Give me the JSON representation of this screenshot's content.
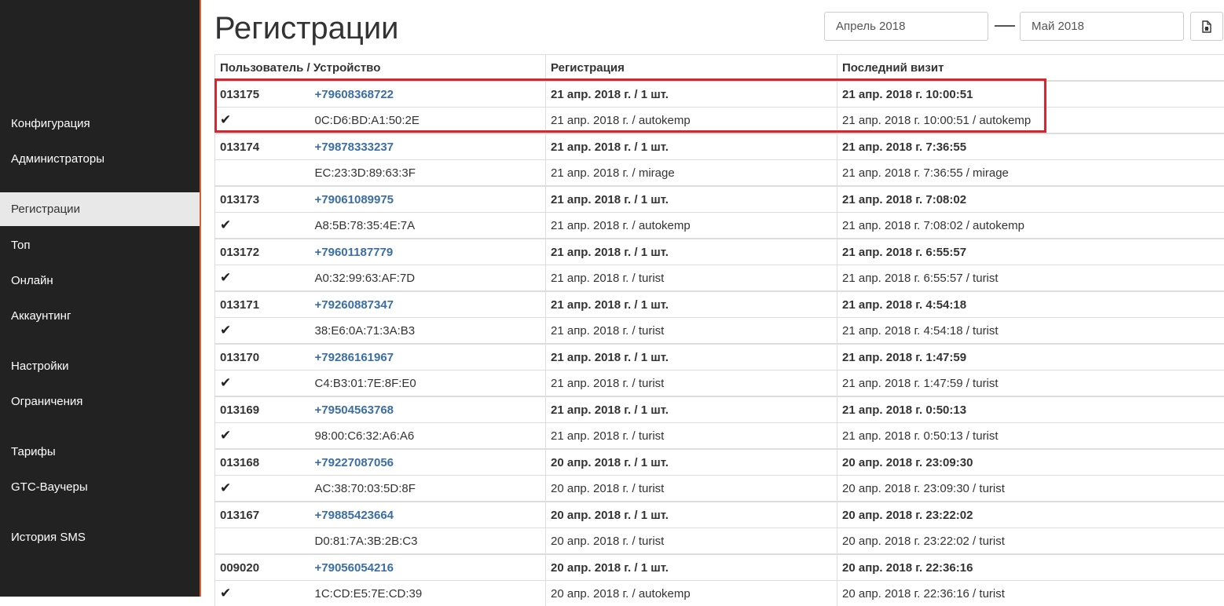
{
  "sidebar": {
    "items": [
      {
        "label": "Конфигурация",
        "active": false
      },
      {
        "label": "Администраторы",
        "active": false
      },
      {
        "label": "Регистрации",
        "active": true
      },
      {
        "label": "Топ",
        "active": false
      },
      {
        "label": "Онлайн",
        "active": false
      },
      {
        "label": "Аккаунтинг",
        "active": false
      },
      {
        "label": "Настройки",
        "active": false
      },
      {
        "label": "Ограничения",
        "active": false
      },
      {
        "label": "Тарифы",
        "active": false
      },
      {
        "label": "GTC-Ваучеры",
        "active": false
      },
      {
        "label": "История SMS",
        "active": false
      }
    ]
  },
  "header": {
    "title": "Регистрации",
    "date_from": "Апрель 2018",
    "date_to": "Май 2018",
    "export_icon": "file-export-icon"
  },
  "table": {
    "columns": [
      "Пользователь / Устройство",
      "Регистрация",
      "Последний визит"
    ],
    "rows": [
      {
        "id": "013175",
        "phone": "+79608368722",
        "reg": "21 апр. 2018 г. / 1 шт.",
        "visit": "21 апр. 2018 г. 10:00:51",
        "check": true,
        "mac": "0C:D6:BD:A1:50:2E",
        "reg_sub": "21 апр. 2018 г. / autokemp",
        "visit_sub": "21 апр. 2018 г. 10:00:51 / autokemp"
      },
      {
        "id": "013174",
        "phone": "+79878333237",
        "reg": "21 апр. 2018 г. / 1 шт.",
        "visit": "21 апр. 2018 г. 7:36:55",
        "check": false,
        "mac": "EC:23:3D:89:63:3F",
        "reg_sub": "21 апр. 2018 г. / mirage",
        "visit_sub": "21 апр. 2018 г. 7:36:55 / mirage"
      },
      {
        "id": "013173",
        "phone": "+79061089975",
        "reg": "21 апр. 2018 г. / 1 шт.",
        "visit": "21 апр. 2018 г. 7:08:02",
        "check": true,
        "mac": "A8:5B:78:35:4E:7A",
        "reg_sub": "21 апр. 2018 г. / autokemp",
        "visit_sub": "21 апр. 2018 г. 7:08:02 / autokemp"
      },
      {
        "id": "013172",
        "phone": "+79601187779",
        "reg": "21 апр. 2018 г. / 1 шт.",
        "visit": "21 апр. 2018 г. 6:55:57",
        "check": true,
        "mac": "A0:32:99:63:AF:7D",
        "reg_sub": "21 апр. 2018 г. / turist",
        "visit_sub": "21 апр. 2018 г. 6:55:57 / turist"
      },
      {
        "id": "013171",
        "phone": "+79260887347",
        "reg": "21 апр. 2018 г. / 1 шт.",
        "visit": "21 апр. 2018 г. 4:54:18",
        "check": true,
        "mac": "38:E6:0A:71:3A:B3",
        "reg_sub": "21 апр. 2018 г. / turist",
        "visit_sub": "21 апр. 2018 г. 4:54:18 / turist"
      },
      {
        "id": "013170",
        "phone": "+79286161967",
        "reg": "21 апр. 2018 г. / 1 шт.",
        "visit": "21 апр. 2018 г. 1:47:59",
        "check": true,
        "mac": "C4:B3:01:7E:8F:E0",
        "reg_sub": "21 апр. 2018 г. / turist",
        "visit_sub": "21 апр. 2018 г. 1:47:59 / turist"
      },
      {
        "id": "013169",
        "phone": "+79504563768",
        "reg": "21 апр. 2018 г. / 1 шт.",
        "visit": "21 апр. 2018 г. 0:50:13",
        "check": true,
        "mac": "98:00:C6:32:A6:A6",
        "reg_sub": "21 апр. 2018 г. / turist",
        "visit_sub": "21 апр. 2018 г. 0:50:13 / turist"
      },
      {
        "id": "013168",
        "phone": "+79227087056",
        "reg": "20 апр. 2018 г. / 1 шт.",
        "visit": "20 апр. 2018 г. 23:09:30",
        "check": true,
        "mac": "AC:38:70:03:5D:8F",
        "reg_sub": "20 апр. 2018 г. / turist",
        "visit_sub": "20 апр. 2018 г. 23:09:30 / turist"
      },
      {
        "id": "013167",
        "phone": "+79885423664",
        "reg": "20 апр. 2018 г. / 1 шт.",
        "visit": "20 апр. 2018 г. 23:22:02",
        "check": false,
        "mac": "D0:81:7A:3B:2B:C3",
        "reg_sub": "20 апр. 2018 г. / turist",
        "visit_sub": "20 апр. 2018 г. 23:22:02 / turist"
      },
      {
        "id": "009020",
        "phone": "+79056054216",
        "reg": "20 апр. 2018 г. / 1 шт.",
        "visit": "20 апр. 2018 г. 22:36:16",
        "check": true,
        "mac": "1C:CD:E5:7E:CD:39",
        "reg_sub": "20 апр. 2018 г. / autokemp",
        "visit_sub": "20 апр. 2018 г. 22:36:16 / turist"
      }
    ]
  },
  "colors": {
    "sidebar_bg": "#222222",
    "sidebar_active_bg": "#e8e8e8",
    "sidebar_accent": "#e05a2b",
    "link": "#3a6ea5",
    "highlight": "#d9252f"
  }
}
